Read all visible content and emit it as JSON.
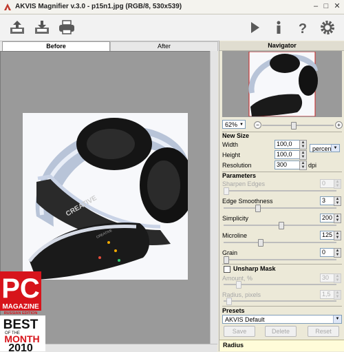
{
  "window": {
    "title": "AKVIS Magnifier v.3.0 - p15n1.jpg (RGB/8, 530x539)"
  },
  "tabs": {
    "before": "Before",
    "after": "After"
  },
  "navigator": {
    "title": "Navigator",
    "zoom": "62%",
    "zoom_minus": "−",
    "zoom_plus": "+"
  },
  "new_size": {
    "title": "New Size",
    "width_label": "Width",
    "width_value": "100,0",
    "height_label": "Height",
    "height_value": "100,0",
    "unit": "percent",
    "resolution_label": "Resolution",
    "resolution_value": "300",
    "resolution_unit": "dpi"
  },
  "parameters": {
    "title": "Parameters",
    "sharpen_label": "Sharpen Edges",
    "sharpen_value": "0",
    "edge_label": "Edge Smoothness",
    "edge_value": "3",
    "simplicity_label": "Simplicity",
    "simplicity_value": "200",
    "microline_label": "Microline",
    "microline_value": "125",
    "grain_label": "Grain",
    "grain_value": "0"
  },
  "unsharp": {
    "title": "Unsharp Mask",
    "amount_label": "Amount, %",
    "amount_value": "30",
    "radius_label": "Radius, pixels",
    "radius_value": "1,5"
  },
  "presets": {
    "title": "Presets",
    "selected": "AKVIS Default",
    "save": "Save",
    "delete": "Delete",
    "reset": "Reset"
  },
  "hint": "Radius",
  "badge": {
    "line1": "PC",
    "line2": "MAGAZINE",
    "line3": "RUSSIAN EDITION",
    "line4": "BEST",
    "line5": "OF THE",
    "line6": "MONTH",
    "line7": "2010"
  },
  "photo": {
    "brand": "CREATIVE"
  },
  "colors": {
    "badge_red": "#d7141b",
    "panel_bg": "#ece9d8",
    "canvas_bg": "#9a9a9a",
    "hint_bg": "#fffcd9"
  }
}
